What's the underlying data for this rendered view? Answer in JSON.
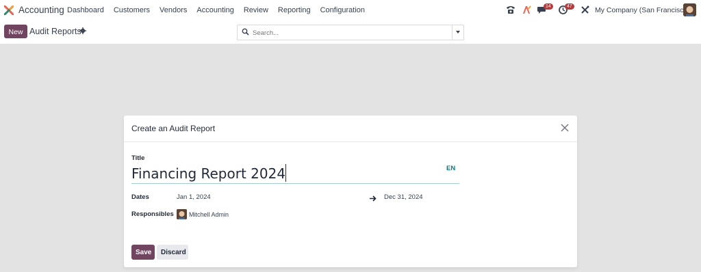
{
  "navbar": {
    "app_name": "Accounting",
    "menu": [
      "Dashboard",
      "Customers",
      "Vendors",
      "Accounting",
      "Review",
      "Reporting",
      "Configuration"
    ],
    "messages_badge": "14",
    "activities_badge": "47",
    "company": "My Company (San Francisco)"
  },
  "control_panel": {
    "new_label": "New",
    "breadcrumb": "Audit Reports",
    "search_placeholder": "Search..."
  },
  "dialog": {
    "title": "Create an Audit Report",
    "title_label": "Title",
    "title_value": "Financing Report 2024",
    "language": "EN",
    "dates_label": "Dates",
    "date_from": "Jan 1, 2024",
    "date_to": "Dec 31, 2024",
    "responsibles_label": "Responsibles",
    "responsible": "Mitchell Admin",
    "save_label": "Save",
    "discard_label": "Discard"
  },
  "colors": {
    "primary": "#71445f",
    "accent": "#017e84",
    "badge": "#b83a3a"
  }
}
